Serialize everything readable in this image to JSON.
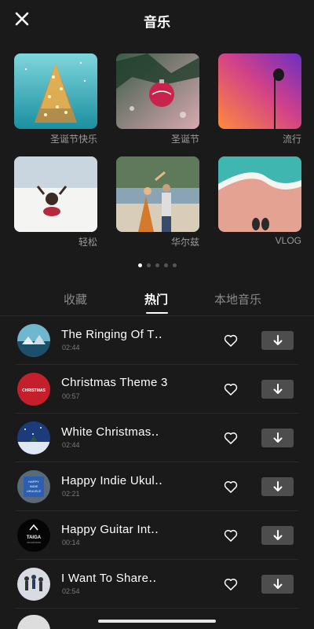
{
  "header": {
    "title": "音乐",
    "close_icon": "close-icon"
  },
  "categories": [
    {
      "label": "圣诞节快乐",
      "theme": "christmas-tree"
    },
    {
      "label": "圣诞节",
      "theme": "ornament"
    },
    {
      "label": "流行",
      "theme": "pop-microphone"
    },
    {
      "label": "轻松",
      "theme": "relax-beach"
    },
    {
      "label": "华尔兹",
      "theme": "waltz-dance"
    },
    {
      "label": "VLOG",
      "theme": "vlog-shore"
    }
  ],
  "pagination": {
    "total": 5,
    "active": 0
  },
  "tabs": [
    {
      "label": "收藏",
      "active": false
    },
    {
      "label": "热门",
      "active": true
    },
    {
      "label": "本地音乐",
      "active": false
    }
  ],
  "tracks": [
    {
      "title": "The Ringing Of T‥",
      "duration": "02:44",
      "cover": "winter-landscape"
    },
    {
      "title": "Christmas Theme 3",
      "duration": "00:57",
      "cover": "christmas-red"
    },
    {
      "title": "White Christmas‥",
      "duration": "02:44",
      "cover": "night-snow"
    },
    {
      "title": "Happy Indie Ukul‥",
      "duration": "02:21",
      "cover": "happy-indie-ukulele"
    },
    {
      "title": "Happy Guitar Int‥",
      "duration": "00:14",
      "cover": "taiga-logo"
    },
    {
      "title": "I Want To Share‥",
      "duration": "02:54",
      "cover": "people-jumping"
    }
  ],
  "cover_text": {
    "christmas": "CHRISTMAS",
    "taiga": "TAIGA",
    "taiga_sub": "SOUND PROD",
    "ukulele": [
      "HAPPY",
      "INDIE",
      "UKULELE"
    ]
  },
  "colors": {
    "background": "#1a1a1a",
    "text": "#ffffff",
    "muted": "#8a8a8a",
    "download_bg": "#4d4d4d"
  }
}
